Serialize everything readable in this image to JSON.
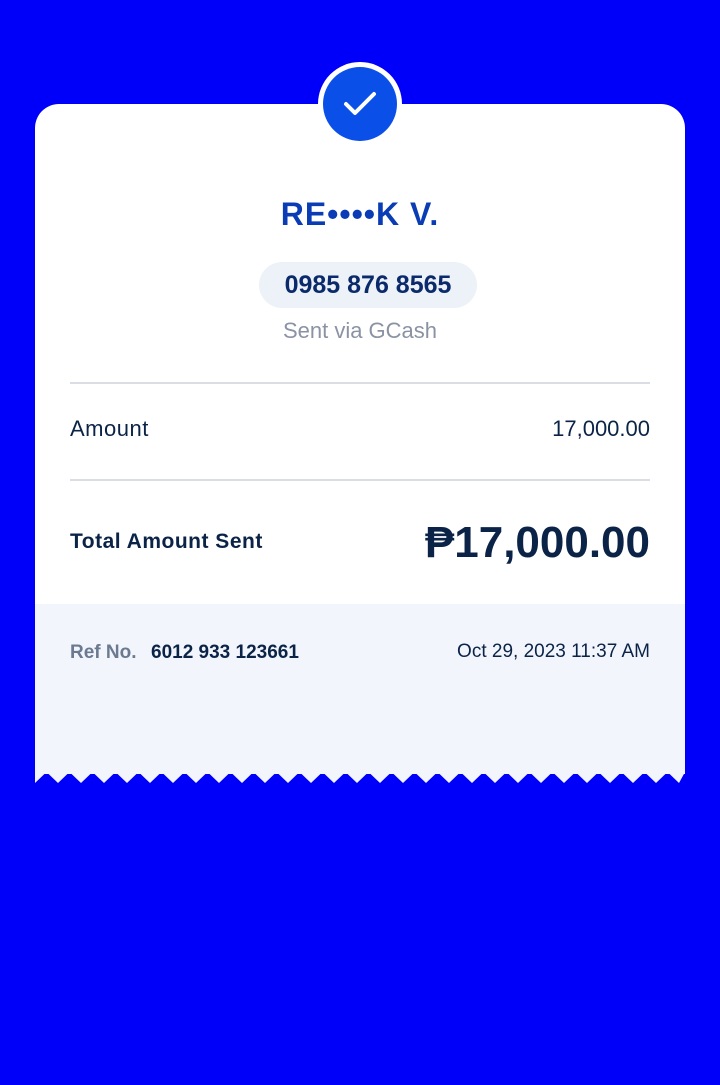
{
  "recipient": {
    "name": "RE••••K V.",
    "phone": "0985 876 8565",
    "channel": "Sent via GCash"
  },
  "status": {
    "icon": "check-icon",
    "state": "success"
  },
  "amount": {
    "label": "Amount",
    "value": "17,000.00"
  },
  "total": {
    "label": "Total Amount Sent",
    "value": "₱17,000.00"
  },
  "reference": {
    "label": "Ref No.",
    "number": "6012 933 123661",
    "timestamp": "Oct 29, 2023 11:37 AM"
  },
  "colors": {
    "background": "#0000FA",
    "accent": "#0A4FE8",
    "name_text": "#0A3CB5",
    "primary_text": "#0B2347",
    "muted_text": "#8A92A3",
    "footer_bg": "#F2F6FC"
  }
}
